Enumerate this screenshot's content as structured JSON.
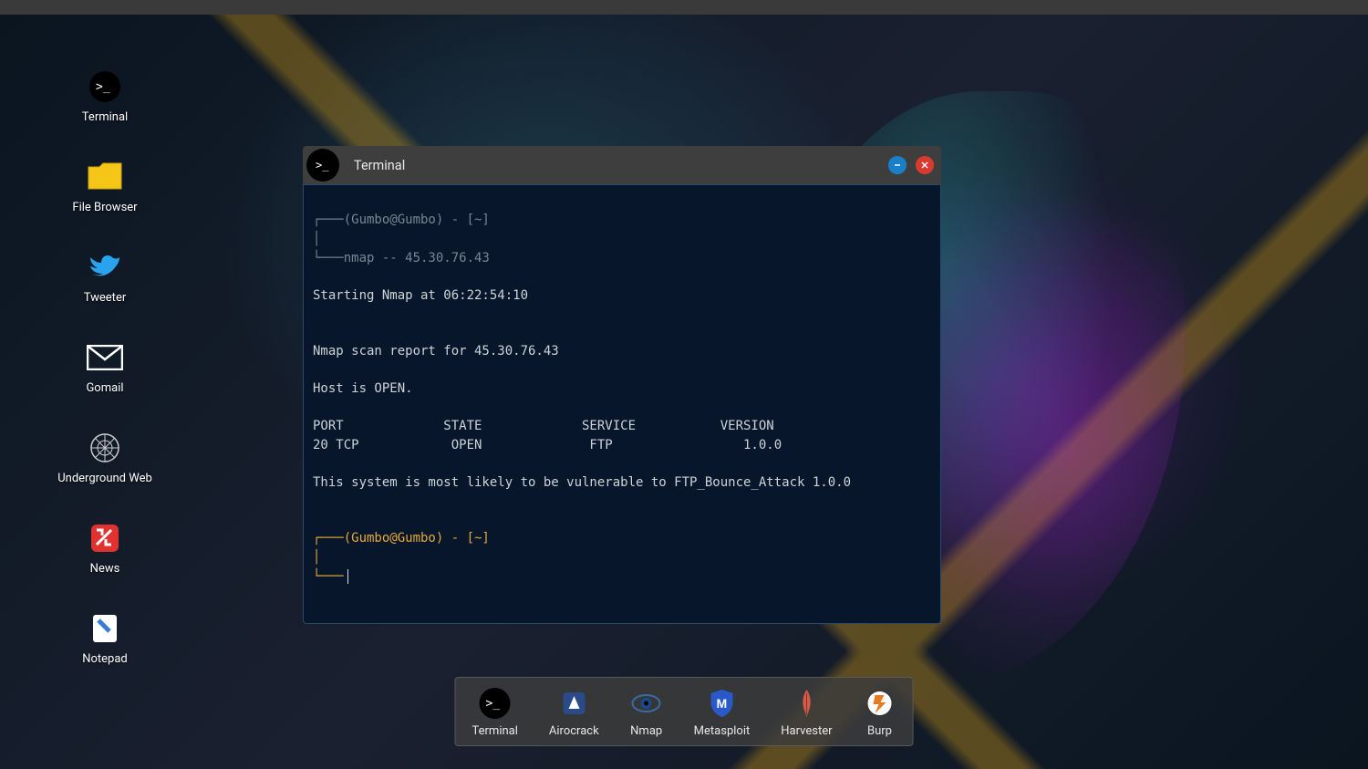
{
  "desktop_icons": [
    {
      "name": "terminal",
      "label": "Terminal"
    },
    {
      "name": "file-browser",
      "label": "File Browser"
    },
    {
      "name": "tweeter",
      "label": "Tweeter"
    },
    {
      "name": "gomail",
      "label": "Gomail"
    },
    {
      "name": "underground-web",
      "label": "Underground Web"
    },
    {
      "name": "news",
      "label": "News"
    },
    {
      "name": "notepad",
      "label": "Notepad"
    }
  ],
  "dock_items": [
    {
      "name": "terminal",
      "label": "Terminal"
    },
    {
      "name": "airocrack",
      "label": "Airocrack"
    },
    {
      "name": "nmap",
      "label": "Nmap"
    },
    {
      "name": "metasploit",
      "label": "Metasploit"
    },
    {
      "name": "harvester",
      "label": "Harvester"
    },
    {
      "name": "burp",
      "label": "Burp"
    }
  ],
  "terminal": {
    "title": "Terminal",
    "prompt1": {
      "line1": "┌───(Gumbo@Gumbo) - [~]",
      "line2": "│",
      "line3": "└───nmap -- 45.30.76.43"
    },
    "output": [
      "Starting Nmap at 06:22:54:10",
      "",
      "",
      "Nmap scan report for 45.30.76.43",
      "",
      "Host is OPEN.",
      "",
      "PORT             STATE             SERVICE           VERSION",
      "20 TCP            OPEN              FTP                 1.0.0",
      "",
      "This system is most likely to be vulnerable to FTP_Bounce_Attack 1.0.0"
    ],
    "prompt2": {
      "line1": "┌───(Gumbo@Gumbo) - [~]",
      "line2": "│",
      "line3": "└───"
    }
  }
}
